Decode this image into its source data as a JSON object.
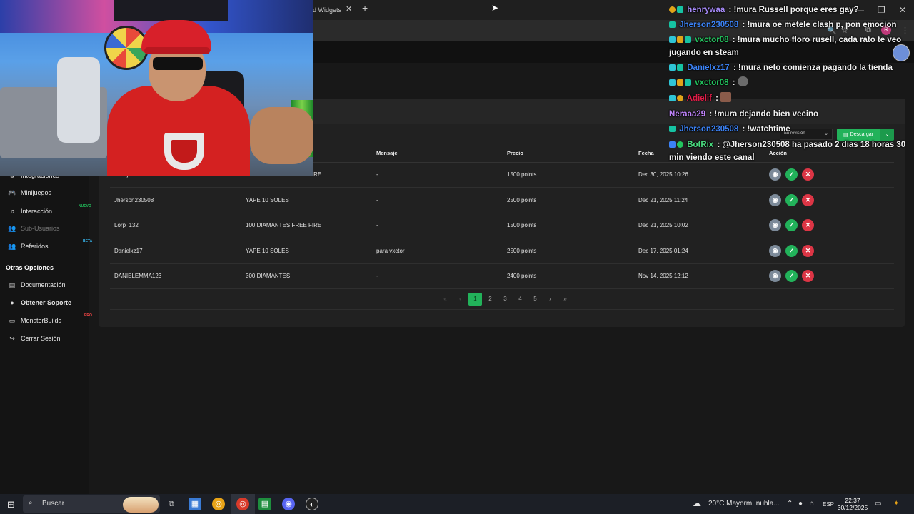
{
  "browser": {
    "tab_title": "d Widgets",
    "tab_close": "✕",
    "tab_new": "+",
    "window_controls": [
      "—",
      "❐",
      "✕"
    ],
    "profile_initial": "R"
  },
  "sidebar": {
    "items": [
      {
        "label": "Integraciones",
        "icon": "plug-icon",
        "glyph": "⚙"
      },
      {
        "label": "Minijuegos",
        "icon": "gamepad-icon",
        "glyph": "🎮"
      },
      {
        "label": "Interacción",
        "icon": "music-icon",
        "glyph": "♫",
        "badge": "NUEVO"
      },
      {
        "label": "Sub-Usuarios",
        "icon": "users-icon",
        "glyph": "👥",
        "disabled": true
      },
      {
        "label": "Referidos",
        "icon": "referral-icon",
        "glyph": "👥",
        "badge": "BETA"
      }
    ],
    "section_heading": "Otras Opciones",
    "other_items": [
      {
        "label": "Documentación",
        "icon": "book-icon",
        "glyph": "▤"
      },
      {
        "label": "Obtener Soporte",
        "icon": "help-icon",
        "glyph": "●"
      },
      {
        "label": "MonsterBuilds",
        "icon": "monitor-icon",
        "glyph": "▭",
        "badge": "PRO"
      },
      {
        "label": "Cerrar Sesión",
        "icon": "logout-icon",
        "glyph": "↪"
      }
    ]
  },
  "filters": {
    "status_select": "En revisión",
    "download_label": "Descargar"
  },
  "table": {
    "columns": [
      "",
      "",
      "Mensaje",
      "Precio",
      "Fecha",
      "Acción"
    ],
    "rows": [
      {
        "user": "Adielj",
        "item": "100 DIAMANTES FREE FIRE",
        "message": "-",
        "price": "1500 points",
        "date": "Dec 30, 2025 10:26"
      },
      {
        "user": "Jherson230508",
        "item": "YAPE 10 SOLES",
        "message": "-",
        "price": "2500 points",
        "date": "Dec 21, 2025 11:24"
      },
      {
        "user": "Lorp_132",
        "item": "100 DIAMANTES FREE FIRE",
        "message": "-",
        "price": "1500 points",
        "date": "Dec 21, 2025 10:02"
      },
      {
        "user": "Danielxz17",
        "item": "YAPE 10 SOLES",
        "message": "para vxctor",
        "price": "2500 points",
        "date": "Dec 17, 2025 01:24"
      },
      {
        "user": "DANIELEMMA123",
        "item": "300 DIAMANTES",
        "message": "-",
        "price": "2400 points",
        "date": "Nov 14, 2025 12:12"
      }
    ]
  },
  "pagination": {
    "first": "«",
    "prev": "‹",
    "pages": [
      "1",
      "2",
      "3",
      "4",
      "5"
    ],
    "current": "1",
    "next": "›",
    "last": "»"
  },
  "chat": {
    "messages": [
      {
        "user": "henrywaa",
        "color": "#a78bfa",
        "text": " : !mura Russell porque eres gay?"
      },
      {
        "user": "Jherson230508",
        "color": "#3b82f6",
        "text": " : !mura oe metele clash p, pon emocion"
      },
      {
        "user": "vxctor08",
        "color": "#22c55e",
        "text": " : !mura mucho floro rusell, cada rato te veo jugando en steam"
      },
      {
        "user": "Danielxz17",
        "color": "#3b82f6",
        "text": " : !mura neto comienza pagando la tienda"
      },
      {
        "user": "vxctor08",
        "color": "#22c55e",
        "text": " :"
      },
      {
        "user": "Adielif",
        "color": "#e11d48",
        "text": " :"
      },
      {
        "user": "Neraaa29",
        "color": "#c084fc",
        "text": " : !mura dejando bien vecino"
      },
      {
        "user": "Jherson230508",
        "color": "#3b82f6",
        "text": " : !watchtime"
      },
      {
        "user": "BotRix",
        "color": "#4ade80",
        "text": " : @Jherson230508 ha pasado 2 dias 18 horas 30 min viendo este canal"
      }
    ]
  },
  "taskbar": {
    "search_placeholder": "Buscar",
    "weather": "20°C  Mayorm. nubla...",
    "language": "ESP",
    "time": "22:37",
    "date": "30/12/2025"
  }
}
